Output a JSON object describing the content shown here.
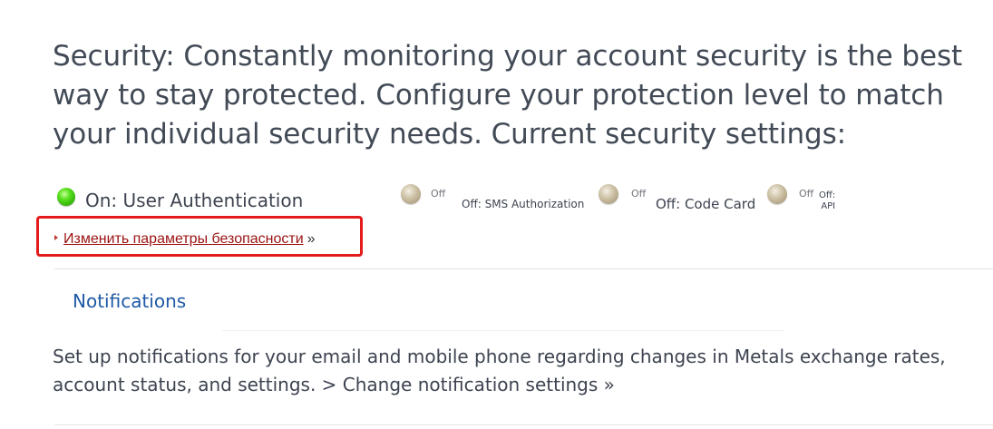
{
  "security": {
    "headline": "Security: Constantly monitoring your account security is the best way to stay protected. Configure your protection level to match your individual security needs. Current security settings:",
    "statuses": [
      {
        "state": "on",
        "label": "On: User Authentication",
        "led_color": "#3fc213"
      },
      {
        "state": "off",
        "mini": "Off",
        "label": "Off: SMS Authorization",
        "led_color": "#b8aa8c"
      },
      {
        "state": "off",
        "mini": "Off",
        "label": "Off: Code Card",
        "led_color": "#b8aa8c"
      },
      {
        "state": "off",
        "mini": "Off",
        "label_line1": "Off:",
        "label_line2": "API",
        "led_color": "#b8aa8c"
      }
    ],
    "change_link": "Изменить параметры безопасности",
    "change_suffix": "»",
    "highlight_color": "#e31b1b"
  },
  "notifications": {
    "title": "Notifications",
    "text": "Set up notifications for your email and mobile phone regarding changes in Metals exchange rates, account status, and settings.",
    "link": "> Change notification settings »"
  },
  "colors": {
    "link": "#9b1111",
    "heading_blue": "#1f5aa6",
    "text": "#3d4350"
  }
}
